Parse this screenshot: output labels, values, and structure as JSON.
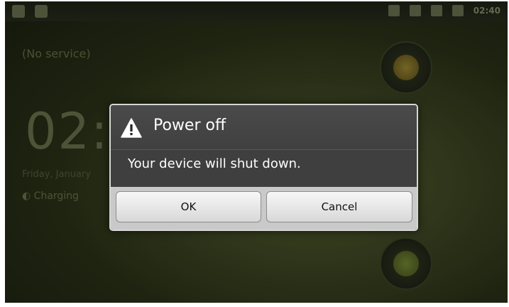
{
  "status_bar": {
    "time": "02:40"
  },
  "lockscreen": {
    "network_status": "(No service)",
    "clock": "02:",
    "date": "Friday, January",
    "charging": "Charging"
  },
  "dialog": {
    "title": "Power off",
    "icon": "warning-icon",
    "message": "Your device will shut down.",
    "buttons": {
      "ok": "OK",
      "cancel": "Cancel"
    }
  },
  "colors": {
    "dialog_bg": "#3f3f3f",
    "button_bar_bg": "#c9c9c9",
    "title_text": "#ffffff"
  }
}
